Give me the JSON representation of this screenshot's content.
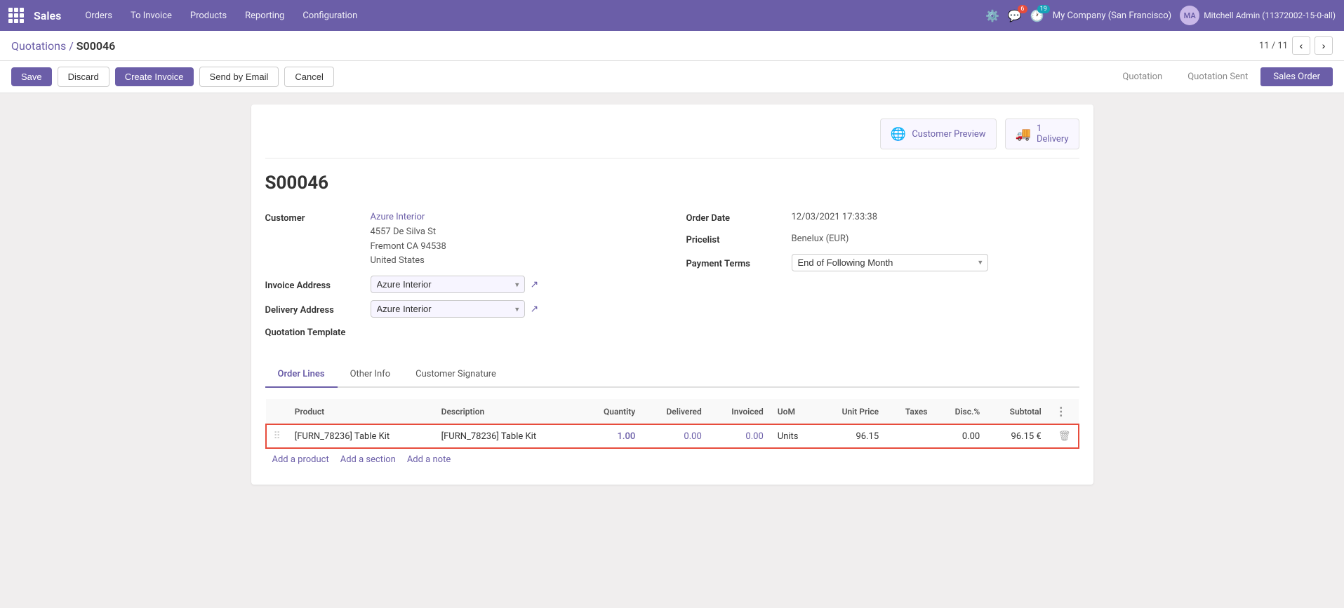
{
  "topnav": {
    "app_name": "Sales",
    "nav_links": [
      "Orders",
      "To Invoice",
      "Products",
      "Reporting",
      "Configuration"
    ],
    "company": "My Company (San Francisco)",
    "user": "Mitchell Admin (11372002-15-0-all)",
    "badge_mail": "6",
    "badge_chat": "19"
  },
  "breadcrumb": {
    "parent": "Quotations",
    "current": "S00046"
  },
  "pagination": {
    "current": "11",
    "total": "11"
  },
  "buttons": {
    "save": "Save",
    "discard": "Discard",
    "create_invoice": "Create Invoice",
    "send_by_email": "Send by Email",
    "cancel": "Cancel"
  },
  "status_bar": {
    "items": [
      "Quotation",
      "Quotation Sent",
      "Sales Order"
    ],
    "active_index": 2
  },
  "smart_buttons": {
    "customer_preview": "Customer Preview",
    "delivery": "1\nDelivery"
  },
  "document": {
    "title": "S00046",
    "customer_label": "Customer",
    "customer_name": "Azure Interior",
    "customer_address1": "4557 De Silva St",
    "customer_address2": "Fremont CA 94538",
    "customer_address3": "United States",
    "invoice_address_label": "Invoice Address",
    "invoice_address_value": "Azure Interior",
    "delivery_address_label": "Delivery Address",
    "delivery_address_value": "Azure Interior",
    "quotation_template_label": "Quotation Template",
    "order_date_label": "Order Date",
    "order_date_value": "12/03/2021 17:33:38",
    "pricelist_label": "Pricelist",
    "pricelist_value": "Benelux (EUR)",
    "payment_terms_label": "Payment Terms",
    "payment_terms_value": "End of Following Month"
  },
  "tabs": {
    "items": [
      "Order Lines",
      "Other Info",
      "Customer Signature"
    ],
    "active_index": 0
  },
  "table": {
    "columns": [
      "",
      "Product",
      "Description",
      "Quantity",
      "Delivered",
      "Invoiced",
      "UoM",
      "Unit Price",
      "Taxes",
      "Disc.%",
      "Subtotal",
      ""
    ],
    "rows": [
      {
        "product": "[FURN_78236] Table Kit",
        "description": "[FURN_78236] Table Kit",
        "quantity": "1.00",
        "delivered": "0.00",
        "invoiced": "0.00",
        "uom": "Units",
        "unit_price": "96.15",
        "taxes": "",
        "disc": "0.00",
        "subtotal": "96.15 €"
      }
    ],
    "add_links": [
      "Add a product",
      "Add a section",
      "Add a note"
    ]
  }
}
